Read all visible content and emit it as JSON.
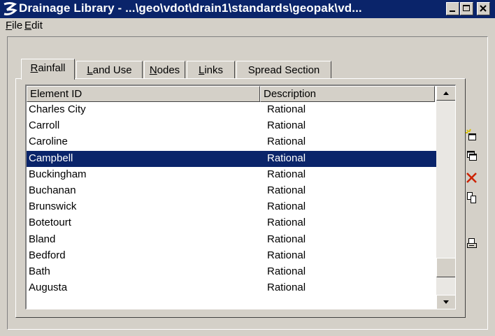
{
  "window": {
    "title": "Drainage Library - ...\\geo\\vdot\\drain1\\standards\\geopak\\vd...",
    "title_bar_color": "#0a246a",
    "selection_color": "#0a246a"
  },
  "menu": {
    "file_accel": "F",
    "file_rest": "ile",
    "edit_accel": "E",
    "edit_rest": "dit"
  },
  "tabs": [
    {
      "accel": "R",
      "rest": "ainfall",
      "active": true
    },
    {
      "accel": "L",
      "rest": "and Use",
      "active": false
    },
    {
      "accel": "N",
      "rest": "odes",
      "active": false
    },
    {
      "accel": "L",
      "rest": "inks",
      "active": false
    },
    {
      "accel": "",
      "rest": "Spread Section",
      "active": false
    }
  ],
  "table": {
    "columns": [
      "Element ID",
      "Description"
    ],
    "selected_index": 3,
    "rows": [
      {
        "id": "Charles City",
        "desc": "Rational"
      },
      {
        "id": "Carroll",
        "desc": "Rational"
      },
      {
        "id": "Caroline",
        "desc": "Rational"
      },
      {
        "id": "Campbell",
        "desc": "Rational"
      },
      {
        "id": "Buckingham",
        "desc": "Rational"
      },
      {
        "id": "Buchanan",
        "desc": "Rational"
      },
      {
        "id": "Brunswick",
        "desc": "Rational"
      },
      {
        "id": "Botetourt",
        "desc": "Rational"
      },
      {
        "id": "Bland",
        "desc": "Rational"
      },
      {
        "id": "Bedford",
        "desc": "Rational"
      },
      {
        "id": "Bath",
        "desc": "Rational"
      },
      {
        "id": "Augusta",
        "desc": "Rational"
      }
    ]
  },
  "side_tools": [
    "new-item-icon",
    "duplicate-icon",
    "delete-icon",
    "copy-icon",
    "print-icon"
  ]
}
